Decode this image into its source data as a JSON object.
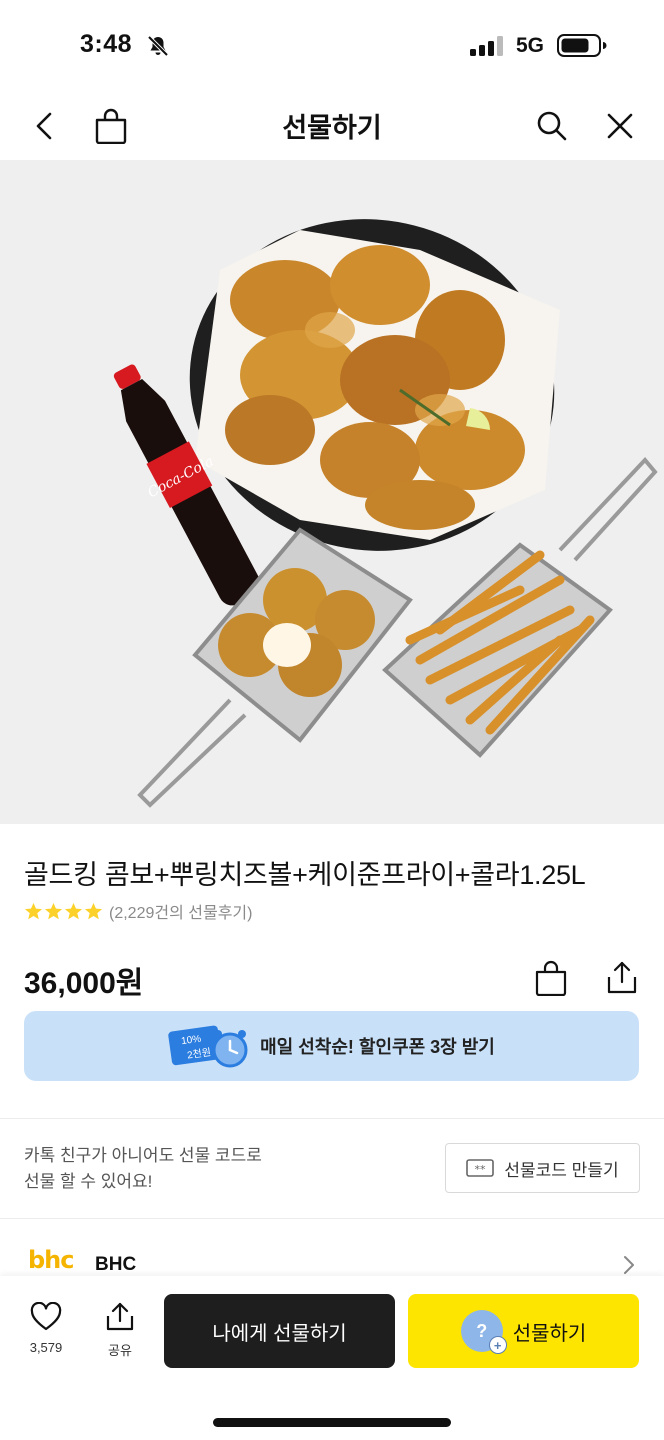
{
  "status_bar": {
    "time": "3:48",
    "network": "5G"
  },
  "nav": {
    "title": "선물하기"
  },
  "product": {
    "name": "골드킹 콤보+뿌링치즈볼+케이준프라이+콜라1.25L",
    "rating": 4,
    "review_count_text": "(2,229건의 선물후기)",
    "price": "36,000원"
  },
  "coupon": {
    "label": "매일 선착순! 할인쿠폰 3장 받기",
    "badge_top": "10%",
    "badge_bottom": "2천원"
  },
  "gift_code": {
    "line1": "카톡 친구가 아니어도 선물 코드로",
    "line2": "선물 할 수 있어요!",
    "button_label": "선물코드 만들기",
    "button_icon_text": "**"
  },
  "brand": {
    "logo_text": "bhc",
    "name": "BHC"
  },
  "bottom_bar": {
    "like_count": "3,579",
    "share_label": "공유",
    "self_gift_label": "나에게 선물하기",
    "gift_label": "선물하기"
  },
  "colors": {
    "accent_yellow": "#fee500",
    "dark_button": "#1e1e1e",
    "coupon_bg": "#c9e1f8",
    "star": "#fcd12a"
  },
  "hero_image": {
    "subject": "product photo"
  }
}
